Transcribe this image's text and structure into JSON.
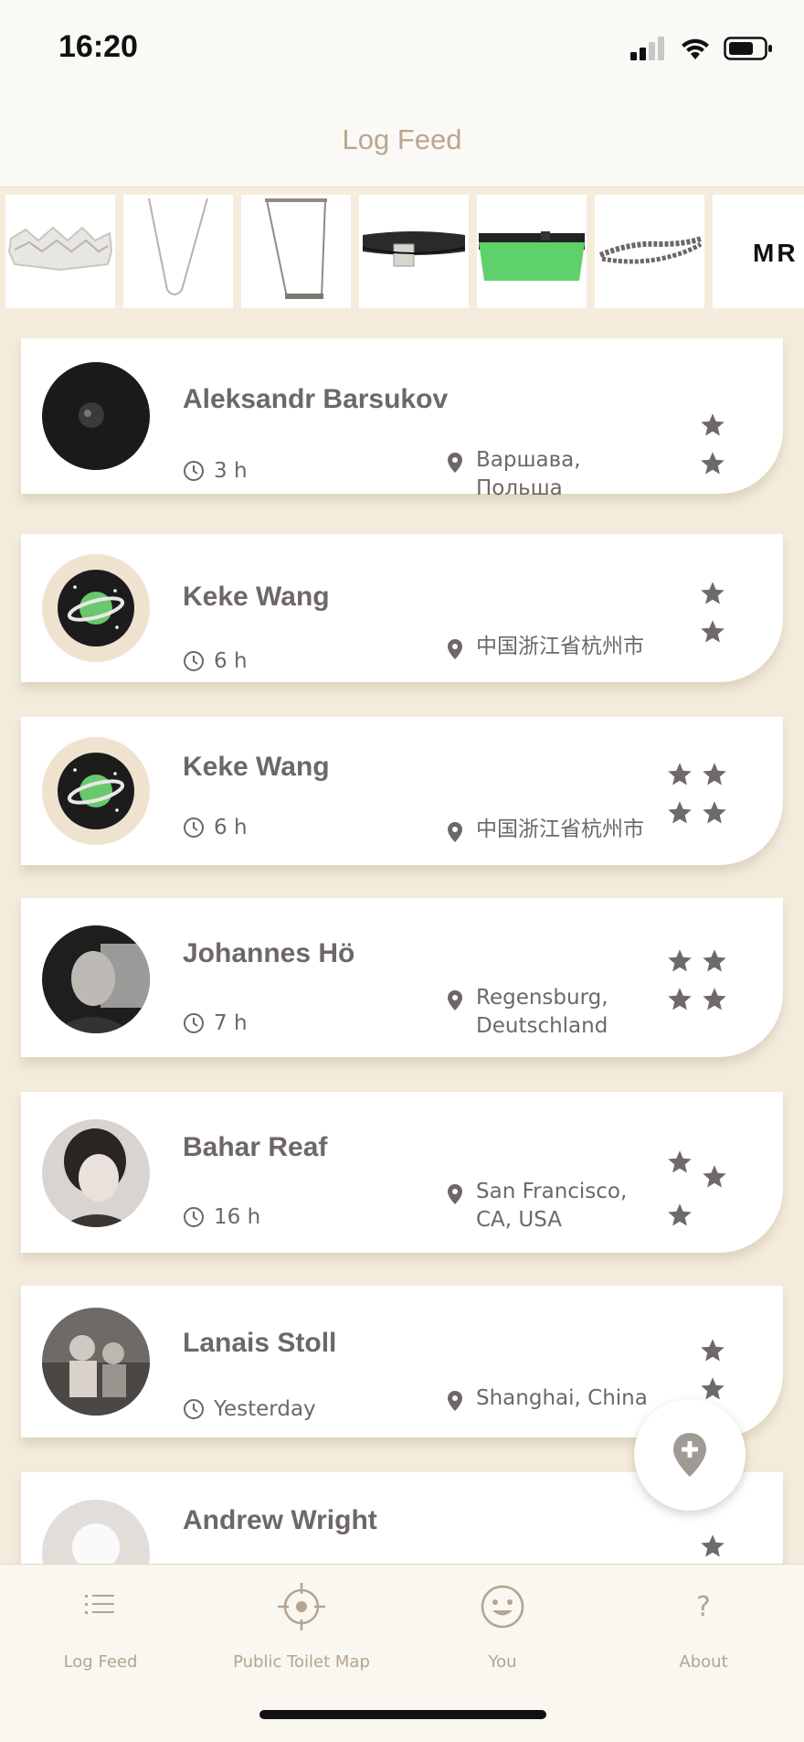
{
  "status_bar": {
    "time": "16:20"
  },
  "header": {
    "title": "Log Feed"
  },
  "product_strip": {
    "items": [
      "zigzag-ring-icon",
      "chain-necklace-icon",
      "bar-necklace-icon",
      "black-belt-icon",
      "green-belt-icon",
      "chain-bracelet-icon"
    ],
    "brand_text": "MR"
  },
  "feed": [
    {
      "name": "Aleksandr  Barsukov",
      "time": "3 h",
      "location": "Варшава,\nПольша",
      "stars": 2,
      "avatar": "dark-photo"
    },
    {
      "name": "Keke Wang",
      "time": "6 h",
      "location": "中国浙江省杭州市",
      "stars": 2,
      "avatar": "planet-logo"
    },
    {
      "name": "Keke Wang",
      "time": "6 h",
      "location": "中国浙江省杭州市",
      "stars": 4,
      "avatar": "planet-logo"
    },
    {
      "name": "Johannes Hö",
      "time": "7 h",
      "location": "Regensburg,\nDeutschland",
      "stars": 4,
      "avatar": "bw-photo"
    },
    {
      "name": "Bahar Reaf",
      "time": "16 h",
      "location": "San Francisco,\nCA, USA",
      "stars": 3,
      "avatar": "portrait-photo"
    },
    {
      "name": "Lanais Stoll",
      "time": "Yesterday",
      "location": "Shanghai, China",
      "stars": 2,
      "avatar": "group-photo"
    },
    {
      "name": "Andrew Wright",
      "time": "",
      "location": "",
      "stars": 2,
      "avatar": "placeholder"
    }
  ],
  "fab": {
    "icon": "add-location-icon"
  },
  "tabs": [
    {
      "label": "Log Feed",
      "icon": "list-icon"
    },
    {
      "label": "Public Toilet Map",
      "icon": "crosshair-icon"
    },
    {
      "label": "You",
      "icon": "smiley-icon"
    },
    {
      "label": "About",
      "icon": "question-icon"
    }
  ],
  "colors": {
    "background": "#f3ebdc",
    "text": "#6e6767",
    "accent": "#b9a78e",
    "green_belt": "#5fd16b"
  }
}
